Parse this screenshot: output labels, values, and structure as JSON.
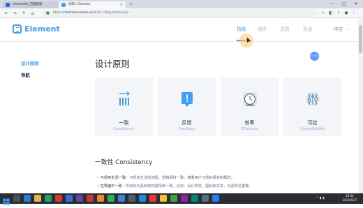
{
  "browser": {
    "tabs": [
      {
        "title": "elementUI_百度搜索",
        "active": false
      },
      {
        "title": "指南 | Element",
        "active": true
      }
    ],
    "new_tab": "+",
    "url_scheme": "https://",
    "url_host": "element.eleme.io",
    "url_path": "/#/zh-CN/guide/design",
    "window_controls": [
      "—",
      "□",
      "✕"
    ]
  },
  "site": {
    "logo_text": "Element",
    "nav": [
      {
        "label": "指南",
        "active": true
      },
      {
        "label": "组件",
        "active": false
      },
      {
        "label": "主题",
        "active": false
      },
      {
        "label": "资源",
        "active": false
      }
    ],
    "language": "中文",
    "badge": "0.4K/s"
  },
  "sidebar": {
    "items": [
      {
        "label": "设计原则",
        "active": true
      },
      {
        "label": "导航",
        "active": false
      }
    ]
  },
  "main": {
    "title": "设计原则",
    "cards": [
      {
        "title": "一致",
        "subtitle": "Consistency",
        "icon": "consistency-bars-icon"
      },
      {
        "title": "反馈",
        "subtitle": "Feedback",
        "icon": "feedback-alert-icon"
      },
      {
        "title": "效率",
        "subtitle": "Efficiency",
        "icon": "efficiency-clock-icon"
      },
      {
        "title": "可控",
        "subtitle": "Controllability",
        "icon": "controllability-sliders-icon"
      }
    ],
    "section_title": "一致性 Consistency",
    "bullets": [
      {
        "lead": "与现实生活一致：",
        "text": "与现实生活的流程、逻辑保持一致，遵循用户习惯的语言和概念；"
      },
      {
        "lead": "在界面中一致：",
        "text": "所有的元素和结构需保持一致，比如：设计样式、图标和文本、元素的位置等。"
      }
    ]
  },
  "taskbar": {
    "time": "18:34",
    "date": "2024/4/27"
  },
  "colors": {
    "brand": "#409eff",
    "text_primary": "#1f2f3d",
    "text_secondary": "#99a9bf",
    "card_bg": "#f3f5f9"
  }
}
